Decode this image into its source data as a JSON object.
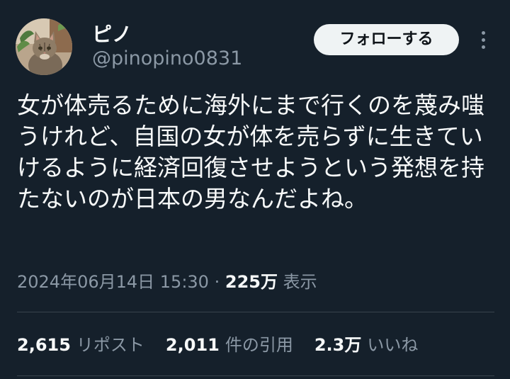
{
  "user": {
    "display_name": "ピノ",
    "handle": "@pinopino0831",
    "avatar": "cat-photo-avatar"
  },
  "actions": {
    "follow_label": "フォローする",
    "more_icon": "more-vertical-icon"
  },
  "tweet": {
    "text": "女が体売るために海外にまで行くのを蔑み嗤うけれど、自国の女が体を売らずに生きていけるように経済回復させようという発想を持たないのが日本の男なんだよね。",
    "timestamp": "2024年06月14日 15:30",
    "separator": "·",
    "views_count": "225万",
    "views_label": "表示"
  },
  "stats": [
    {
      "count": "2,615",
      "label": "リポスト"
    },
    {
      "count": "2,011",
      "label": "件の引用"
    },
    {
      "count": "2.3万",
      "label": "いいね"
    }
  ],
  "colors": {
    "background": "#15202b",
    "text_primary": "#f7f9f9",
    "text_secondary": "#8b98a5",
    "divider": "#38444d",
    "follow_button_bg": "#eff3f4"
  }
}
